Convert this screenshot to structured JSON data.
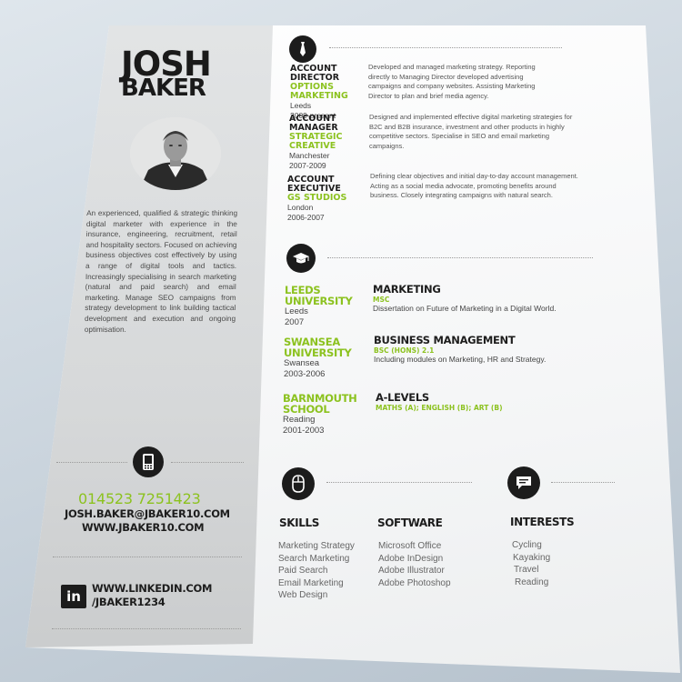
{
  "person": {
    "first_name": "JOSH",
    "last_name": "BAKER",
    "summary": "An experienced, qualified & strategic thinking digital marketer with experience in the insurance, engineering, recruitment, retail and hospitality sectors. Focused on achieving business objectives cost effectively by using a range of digital tools and tactics. Increasingly specialising in search marketing (natural and paid search) and email marketing. Manage SEO campaigns from strategy development to link building tactical development and execution and ongoing optimisation."
  },
  "contact": {
    "phone": "014523 7251423",
    "email": "JOSH.BAKER@JBAKER10.COM",
    "website": "WWW.JBAKER10.COM",
    "linkedin_url": "WWW.LINKEDIN.COM",
    "linkedin_handle": "/JBAKER1234",
    "linkedin_logo": "in"
  },
  "experience": [
    {
      "title_1": "ACCOUNT",
      "title_2": "DIRECTOR",
      "company_1": "OPTIONS",
      "company_2": "MARKETING",
      "location": "Leeds",
      "dates": "2009-present",
      "description": "Developed and managed marketing strategy. Reporting directly to Managing Director developed advertising campaigns and company websites. Assisting Marketing Director to plan and brief media agency."
    },
    {
      "title_1": "ACCOUNT",
      "title_2": "MANAGER",
      "company_1": "STRATEGIC",
      "company_2": "CREATIVE",
      "location": "Manchester",
      "dates": "2007-2009",
      "description": "Designed and implemented effective digital marketing strategies for B2C and B2B insurance, investment and other products in highly competitive sectors. Specialise in SEO and email marketing campaigns."
    },
    {
      "title_1": "ACCOUNT",
      "title_2": "EXECUTIVE",
      "company_1": "GS STUDIOS",
      "company_2": "",
      "location": "London",
      "dates": "2006-2007",
      "description": "Defining clear objectives and initial day-to-day account management. Acting as a social media advocate, promoting benefits around business. Closely integrating campaigns with natural search."
    }
  ],
  "education": [
    {
      "school_1": "LEEDS",
      "school_2": "UNIVERSITY",
      "location": "Leeds",
      "dates": "2007",
      "course": "MARKETING",
      "qualification": "MSC",
      "details": "Dissertation on Future of Marketing in a Digital World."
    },
    {
      "school_1": "SWANSEA",
      "school_2": "UNIVERSITY",
      "location": "Swansea",
      "dates": "2003-2006",
      "course": "BUSINESS MANAGEMENT",
      "qualification": "BSC (HONS) 2.1",
      "details": "Including modules on Marketing, HR and Strategy."
    },
    {
      "school_1": "BARNMOUTH",
      "school_2": "SCHOOL",
      "location": "Reading",
      "dates": "2001-2003",
      "course": "A-LEVELS",
      "qualification": "MATHS (A); ENGLISH (B); ART (B)",
      "details": ""
    }
  ],
  "skills": {
    "heading": "SKILLS",
    "items": [
      "Marketing Strategy",
      "Search Marketing",
      "Paid Search",
      "Email Marketing",
      "Web Design"
    ]
  },
  "software": {
    "heading": "SOFTWARE",
    "items": [
      "Microsoft Office",
      "Adobe InDesign",
      "Adobe Illustrator",
      "Adobe Photoshop"
    ]
  },
  "interests": {
    "heading": "INTERESTS",
    "items": [
      "Cycling",
      "Kayaking",
      "Travel",
      "Reading"
    ]
  },
  "icons": {
    "work": "tie-icon",
    "education": "graduation-cap-icon",
    "contact": "mobile-phone-icon",
    "skills": "mouse-icon",
    "interests": "speech-bubble-icon"
  },
  "colors": {
    "accent": "#8cc21f",
    "dark": "#1d1d1d",
    "sidebar": "#d8dadb"
  }
}
